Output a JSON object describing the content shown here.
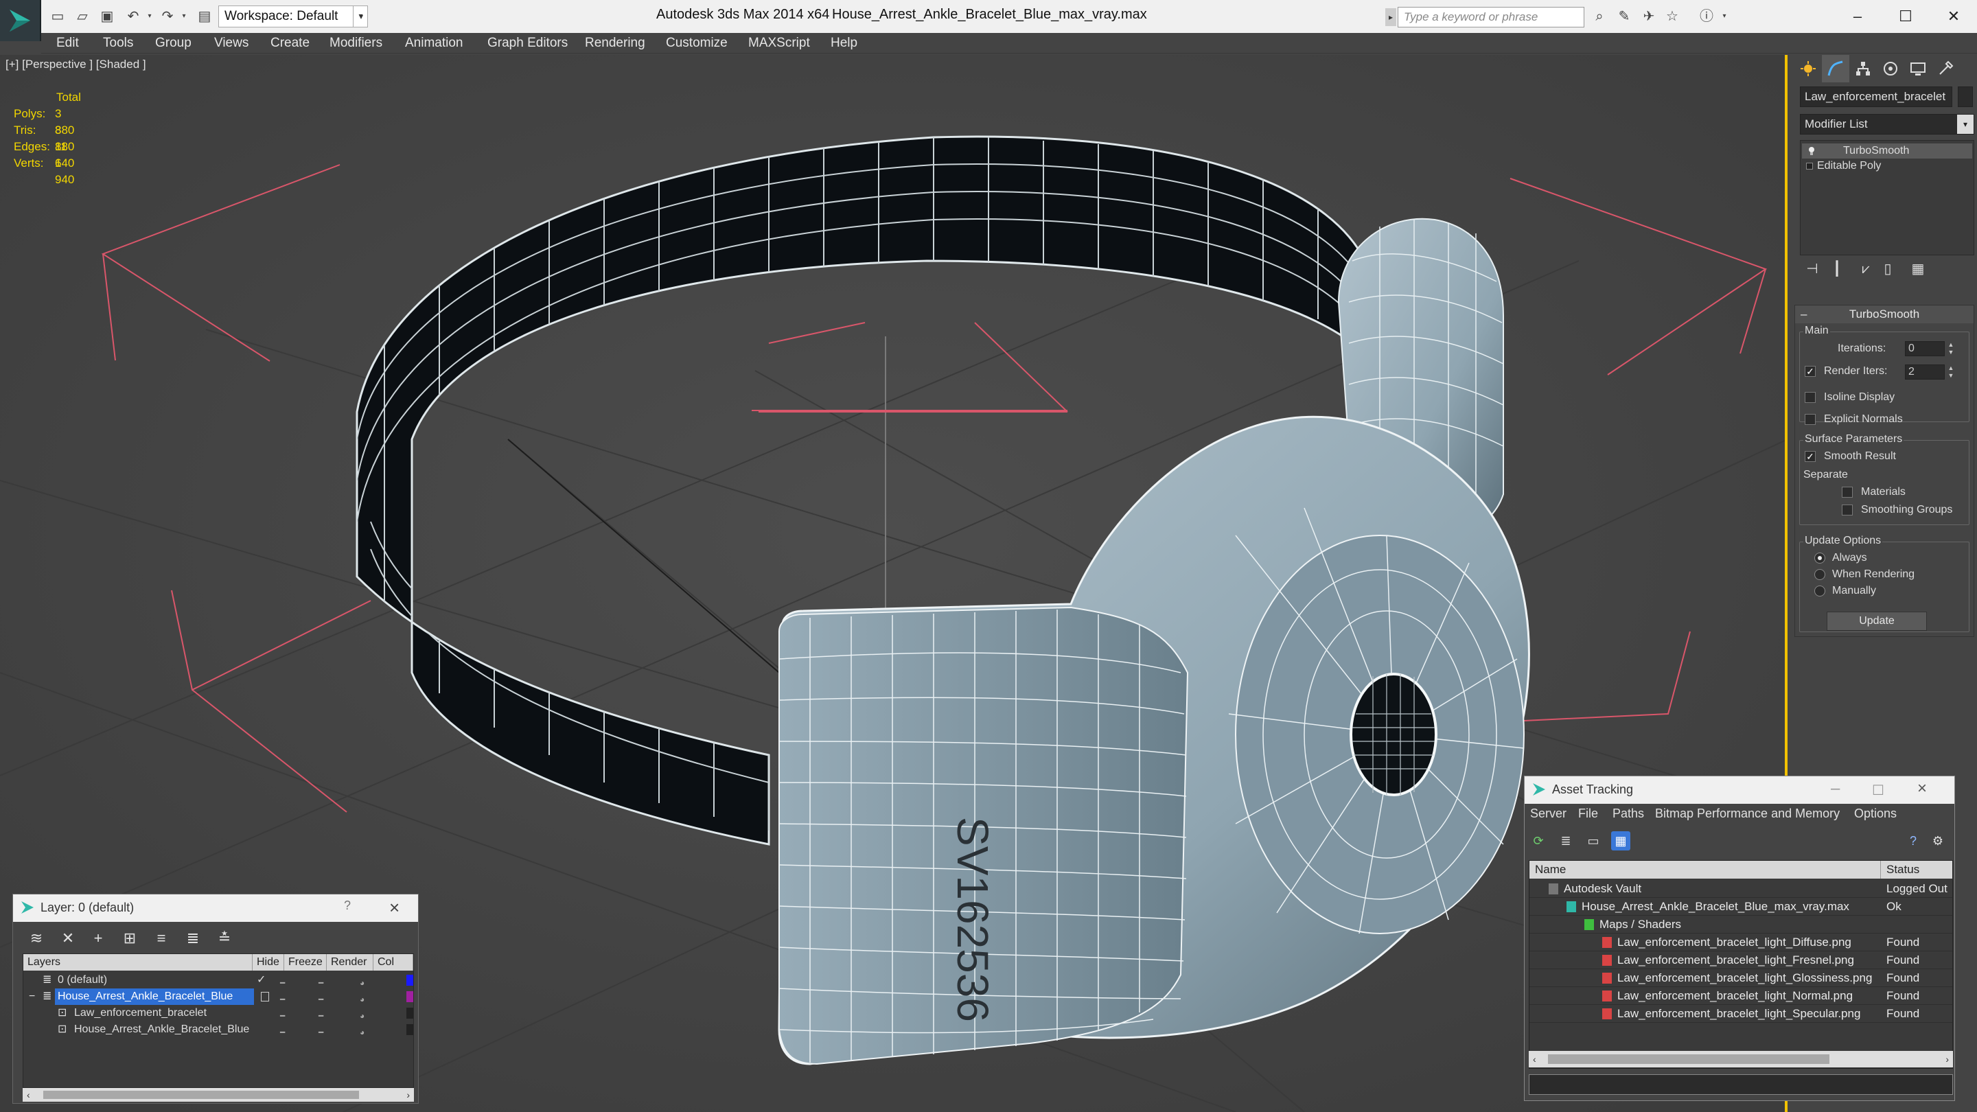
{
  "titlebar": {
    "workspace": "Workspace: Default",
    "app_title": "Autodesk 3ds Max 2014 x64",
    "file_title": "House_Arrest_Ankle_Bracelet_Blue_max_vray.max",
    "search_placeholder": "Type a keyword or phrase"
  },
  "menu": [
    "Edit",
    "Tools",
    "Group",
    "Views",
    "Create",
    "Modifiers",
    "Animation",
    "Graph Editors",
    "Rendering",
    "Customize",
    "MAXScript",
    "Help"
  ],
  "viewport": {
    "label": "[+] [Perspective ] [Shaded ]",
    "stats": {
      "header": "Total",
      "polys_label": "Polys:",
      "polys": "3 880",
      "tris_label": "Tris:",
      "tris": "3 880",
      "edges_label": "Edges:",
      "edges": "11 640",
      "verts_label": "Verts:",
      "verts": "1 940"
    },
    "engraving": "SV162536",
    "accent_color": "#f2c200"
  },
  "command_panel": {
    "object_name": "Law_enforcement_bracelet",
    "modifier_list": "Modifier List",
    "stack": [
      "TurboSmooth",
      "Editable Poly"
    ],
    "rollout_title": "TurboSmooth",
    "main_group": "Main",
    "iterations_label": "Iterations:",
    "iterations": "0",
    "render_iters_label": "Render Iters:",
    "render_iters": "2",
    "isoline_label": "Isoline Display",
    "explicit_normals_label": "Explicit Normals",
    "surface_group": "Surface Parameters",
    "smooth_result_label": "Smooth Result",
    "separate_label": "Separate",
    "materials_label": "Materials",
    "smoothing_groups_label": "Smoothing Groups",
    "update_group": "Update Options",
    "always_label": "Always",
    "when_rendering_label": "When Rendering",
    "manually_label": "Manually",
    "update_button": "Update"
  },
  "layer_window": {
    "title": "Layer: 0 (default)",
    "help": "?",
    "columns": [
      "Layers",
      "Hide",
      "Freeze",
      "Render",
      "Col"
    ],
    "rows": [
      {
        "name": "0 (default)",
        "color": "#1a1aff"
      },
      {
        "name": "House_Arrest_Ankle_Bracelet_Blue",
        "color": "#a020a0"
      },
      {
        "name": "Law_enforcement_bracelet",
        "color": "#222222"
      },
      {
        "name": "House_Arrest_Ankle_Bracelet_Blue",
        "color": "#222222"
      }
    ]
  },
  "asset_window": {
    "title": "Asset Tracking",
    "menu": [
      "Server",
      "File",
      "Paths",
      "Bitmap Performance and Memory",
      "Options"
    ],
    "columns": [
      "Name",
      "Status"
    ],
    "rows": [
      {
        "name": "Autodesk Vault",
        "status": "Logged Out"
      },
      {
        "name": "House_Arrest_Ankle_Bracelet_Blue_max_vray.max",
        "status": "Ok"
      },
      {
        "name": "Maps / Shaders",
        "status": ""
      },
      {
        "name": "Law_enforcement_bracelet_light_Diffuse.png",
        "status": "Found"
      },
      {
        "name": "Law_enforcement_bracelet_light_Fresnel.png",
        "status": "Found"
      },
      {
        "name": "Law_enforcement_bracelet_light_Glossiness.png",
        "status": "Found"
      },
      {
        "name": "Law_enforcement_bracelet_light_Normal.png",
        "status": "Found"
      },
      {
        "name": "Law_enforcement_bracelet_light_Specular.png",
        "status": "Found"
      }
    ]
  }
}
